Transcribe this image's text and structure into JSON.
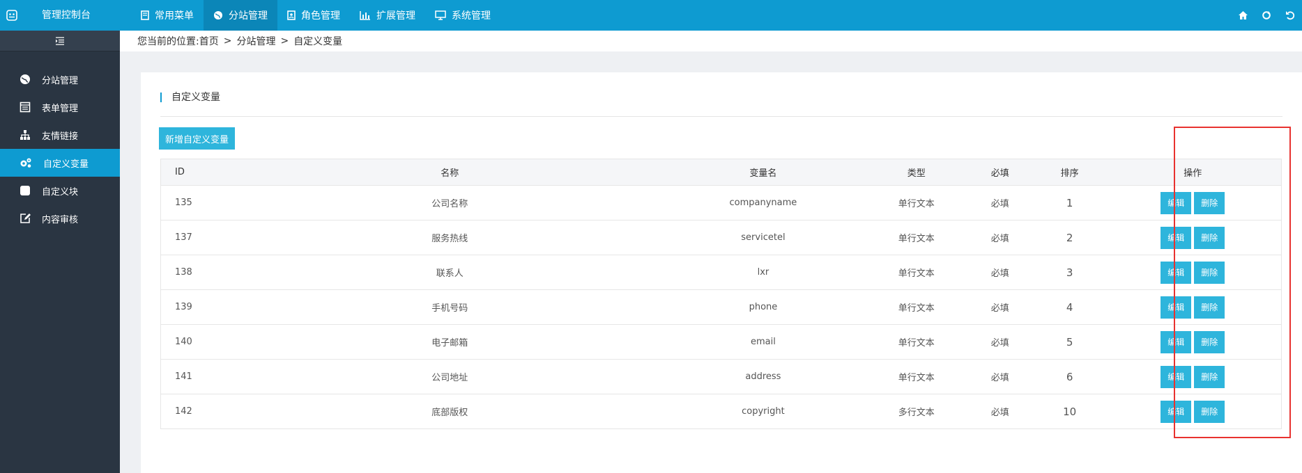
{
  "header": {
    "brand": "管理控制台",
    "nav": [
      {
        "label": "常用菜单",
        "icon": "bookmark-icon"
      },
      {
        "label": "分站管理",
        "icon": "globe-icon"
      },
      {
        "label": "角色管理",
        "icon": "id-card-icon"
      },
      {
        "label": "扩展管理",
        "icon": "bar-chart-icon"
      },
      {
        "label": "系统管理",
        "icon": "monitor-icon"
      }
    ],
    "active_nav": "分站管理"
  },
  "sidebar": {
    "items": [
      {
        "label": "分站管理",
        "icon": "globe-icon"
      },
      {
        "label": "表单管理",
        "icon": "form-icon"
      },
      {
        "label": "友情链接",
        "icon": "sitemap-icon"
      },
      {
        "label": "自定义变量",
        "icon": "gears-icon"
      },
      {
        "label": "自定义块",
        "icon": "square-icon"
      },
      {
        "label": "内容审核",
        "icon": "edit-icon"
      }
    ],
    "active": "自定义变量"
  },
  "breadcrumb": {
    "prefix": "您当前的位置:",
    "items": [
      "首页",
      "分站管理",
      "自定义变量"
    ],
    "separator": ">"
  },
  "panel": {
    "title": "自定义变量",
    "add_button": "新增自定义变量"
  },
  "table": {
    "columns": [
      "ID",
      "名称",
      "变量名",
      "类型",
      "必填",
      "排序",
      "操作"
    ],
    "rows": [
      {
        "id": "135",
        "name": "公司名称",
        "var": "companyname",
        "type": "单行文本",
        "required": "必填",
        "sort": "1"
      },
      {
        "id": "137",
        "name": "服务热线",
        "var": "servicetel",
        "type": "单行文本",
        "required": "必填",
        "sort": "2"
      },
      {
        "id": "138",
        "name": "联系人",
        "var": "lxr",
        "type": "单行文本",
        "required": "必填",
        "sort": "3"
      },
      {
        "id": "139",
        "name": "手机号码",
        "var": "phone",
        "type": "单行文本",
        "required": "必填",
        "sort": "4"
      },
      {
        "id": "140",
        "name": "电子邮箱",
        "var": "email",
        "type": "单行文本",
        "required": "必填",
        "sort": "5"
      },
      {
        "id": "141",
        "name": "公司地址",
        "var": "address",
        "type": "单行文本",
        "required": "必填",
        "sort": "6"
      },
      {
        "id": "142",
        "name": "底部版权",
        "var": "copyright",
        "type": "多行文本",
        "required": "必填",
        "sort": "10"
      }
    ],
    "edit_label": "编辑",
    "delete_label": "删除"
  },
  "colors": {
    "topbar": "#0e9bd1",
    "sidebar": "#2a3542",
    "button": "#2eb5dc",
    "highlight": "#e8322f"
  }
}
